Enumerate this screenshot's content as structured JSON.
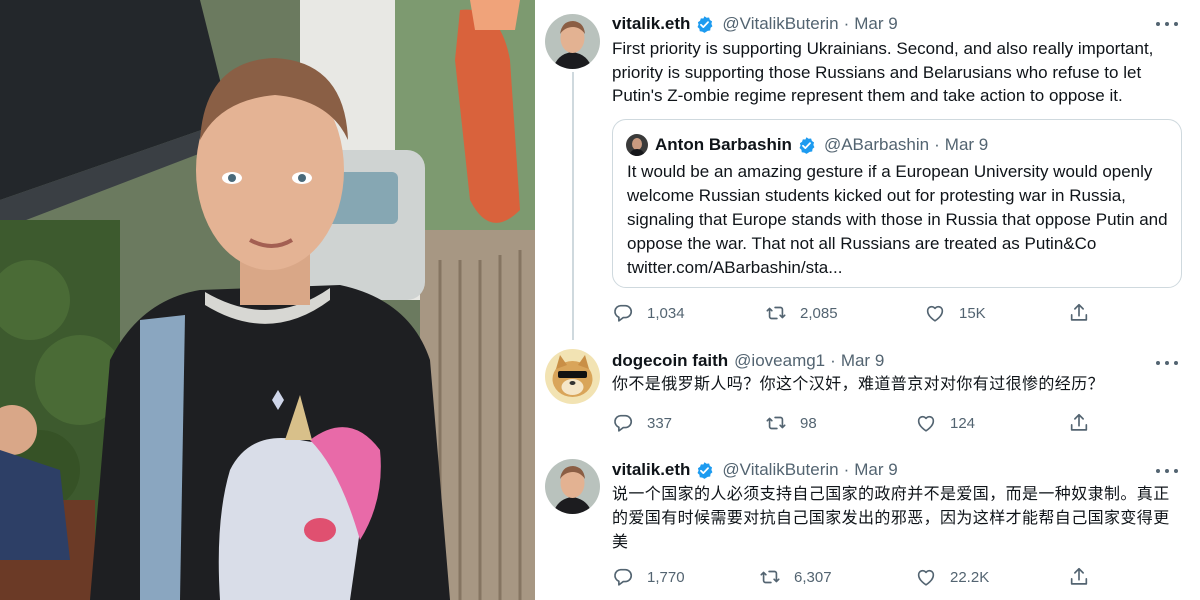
{
  "tweets": [
    {
      "name": "vitalik.eth",
      "handle": "@VitalikButerin",
      "dot": "·",
      "date": "Mar 9",
      "text": "First priority is supporting Ukrainians. Second, and also really important, priority is supporting those Russians and Belarusians who refuse to let Putin's Z-ombie regime represent them and take action to oppose it.",
      "quote": {
        "name": "Anton Barbashin",
        "handle": "@ABarbashin",
        "dot": "·",
        "date": "Mar 9",
        "text": "It would be an amazing gesture if a European University would openly welcome Russian students kicked out for protesting war in Russia, signaling that Europe stands with those in Russia that oppose Putin and oppose the war. That not all Russians are treated as Putin&Co twitter.com/ABarbashin/sta..."
      },
      "replies": "1,034",
      "retweets": "2,085",
      "likes": "15K"
    },
    {
      "name": "dogecoin faith",
      "handle": "@ioveamg1",
      "dot": "·",
      "date": "Mar 9",
      "text": "你不是俄罗斯人吗？你这个汉奸，难道普京对对你有过很惨的经历？",
      "replies": "337",
      "retweets": "98",
      "likes": "124"
    },
    {
      "name": "vitalik.eth",
      "handle": "@VitalikButerin",
      "dot": "·",
      "date": "Mar 9",
      "text": "说一个国家的人必须支持自己国家的政府并不是爱国，而是一种奴隶制。真正的爱国有时候需要对抗自己国家发出的邪恶，因为这样才能帮自己国家变得更美",
      "replies": "1,770",
      "retweets": "6,307",
      "likes": "22.2K"
    }
  ],
  "icons": {
    "verified": "verified-badge-icon",
    "reply": "reply-icon",
    "retweet": "retweet-icon",
    "like": "heart-icon",
    "share": "share-icon",
    "more": "more-icon"
  },
  "colors": {
    "text": "#0f1419",
    "secondary": "#536471",
    "verified": "#1d9bf0",
    "border": "#cfd9de"
  }
}
